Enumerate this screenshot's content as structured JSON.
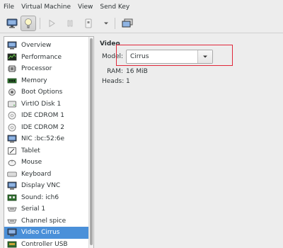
{
  "menubar": {
    "items": [
      "File",
      "Virtual Machine",
      "View",
      "Send Key"
    ]
  },
  "toolbar": {
    "buttons": [
      {
        "icon": "monitor-icon",
        "state": "normal"
      },
      {
        "icon": "lightbulb-icon",
        "state": "active"
      },
      {
        "icon": "play-icon",
        "state": "disabled"
      },
      {
        "icon": "pause-icon",
        "state": "disabled"
      },
      {
        "icon": "power-icon",
        "state": "disabled"
      },
      {
        "icon": "chevron-down-icon",
        "state": "normal"
      },
      {
        "icon": "screens-icon",
        "state": "normal"
      }
    ]
  },
  "sidebar": {
    "items": [
      {
        "label": "Overview",
        "icon": "overview-icon"
      },
      {
        "label": "Performance",
        "icon": "performance-icon"
      },
      {
        "label": "Processor",
        "icon": "processor-icon"
      },
      {
        "label": "Memory",
        "icon": "memory-icon"
      },
      {
        "label": "Boot Options",
        "icon": "boot-options-icon"
      },
      {
        "label": "VirtIO Disk 1",
        "icon": "disk-icon"
      },
      {
        "label": "IDE CDROM 1",
        "icon": "cdrom-icon"
      },
      {
        "label": "IDE CDROM 2",
        "icon": "cdrom-icon"
      },
      {
        "label": "NIC :bc:52:6e",
        "icon": "nic-icon"
      },
      {
        "label": "Tablet",
        "icon": "tablet-icon"
      },
      {
        "label": "Mouse",
        "icon": "mouse-icon"
      },
      {
        "label": "Keyboard",
        "icon": "keyboard-icon"
      },
      {
        "label": "Display VNC",
        "icon": "display-icon"
      },
      {
        "label": "Sound: ich6",
        "icon": "sound-icon"
      },
      {
        "label": "Serial 1",
        "icon": "serial-icon"
      },
      {
        "label": "Channel spice",
        "icon": "channel-icon"
      },
      {
        "label": "Video Cirrus",
        "icon": "video-icon"
      },
      {
        "label": "Controller USB",
        "icon": "controller-icon"
      }
    ],
    "selected_label": "Video Cirrus"
  },
  "details": {
    "section_title": "Video",
    "model_label": "Model:",
    "model_value": "Cirrus",
    "ram_label": "RAM:",
    "ram_value": "16 MiB",
    "heads_label": "Heads:",
    "heads_value": "1"
  },
  "colors": {
    "selection": "#4a90d9",
    "highlight_border": "#e0283a",
    "window_bg": "#ededed"
  }
}
